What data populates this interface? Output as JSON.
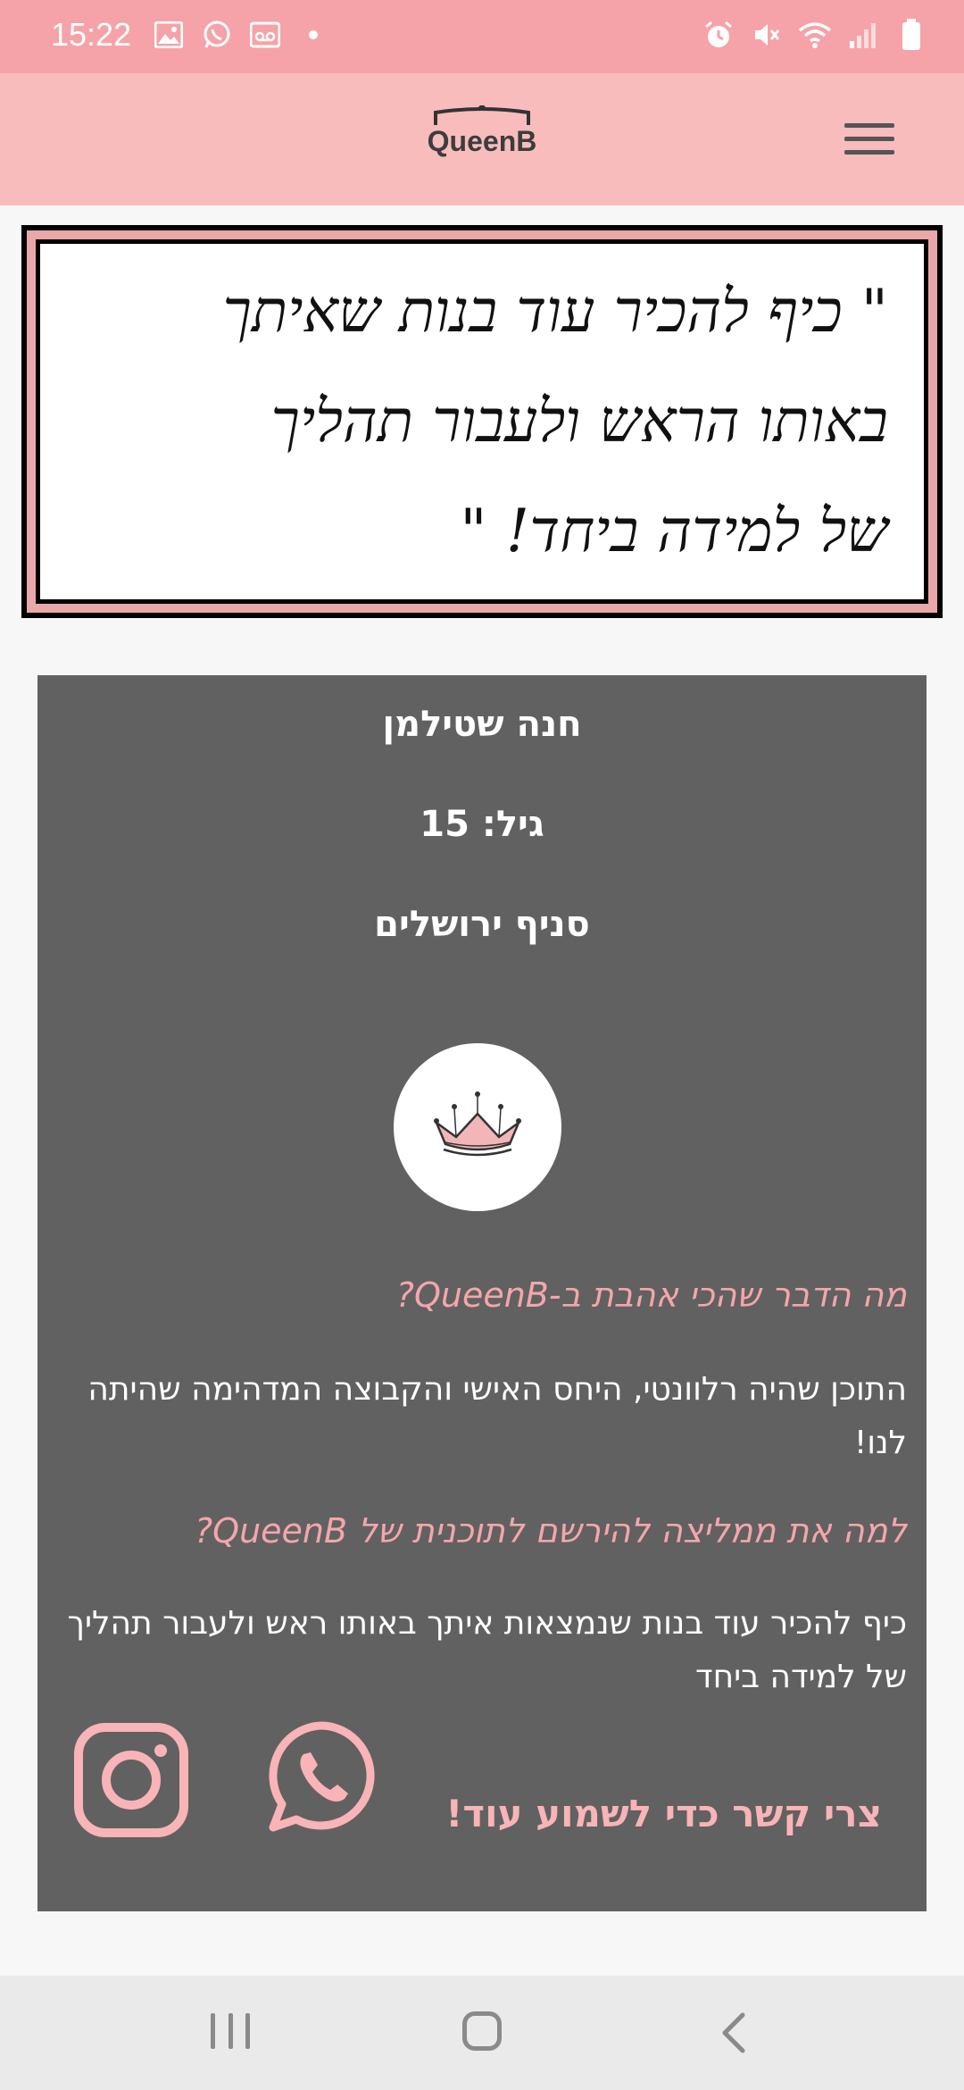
{
  "status_bar": {
    "time": "15:22",
    "left_icons": [
      "gallery-icon",
      "whatsapp-icon",
      "voicemail-icon",
      "dot-icon"
    ],
    "right_icons": [
      "alarm-icon",
      "mute-icon",
      "wifi-icon",
      "signal-icon",
      "battery-icon"
    ]
  },
  "header": {
    "logo_text": "QueenB",
    "menu_icon": "hamburger-icon"
  },
  "banner": {
    "lines": [
      "\" כיף להכיר עוד בנות שאיתך",
      "באותו הראש ולעבור תהליך",
      "של למידה ביחד! \""
    ]
  },
  "profile": {
    "name": "חנה שטילמן",
    "age": "גיל: 15",
    "branch": "סניף ירושלים",
    "avatar_icon": "crown-icon",
    "q1": "מה הדבר שהכי אהבת ב-QueenB?",
    "a1": "התוכן שהיה רלוונטי, היחס האישי והקבוצה המדהימה שהיתה לנו!",
    "q2": "למה את ממליצה להירשם לתוכנית של QueenB?",
    "a2": "כיף להכיר עוד בנות שנמצאות איתך באותו ראש ולעבור תהליך של למידה ביחד",
    "contact_text": "צרי קשר כדי לשמוע עוד!"
  },
  "colors": {
    "status_bar": "#f5a3a8",
    "header": "#f8bcbd",
    "card": "#616161",
    "accent_pink": "#f4a6ab"
  },
  "nav_bar": {
    "icons": [
      "recent-apps-icon",
      "home-icon",
      "back-icon"
    ]
  }
}
